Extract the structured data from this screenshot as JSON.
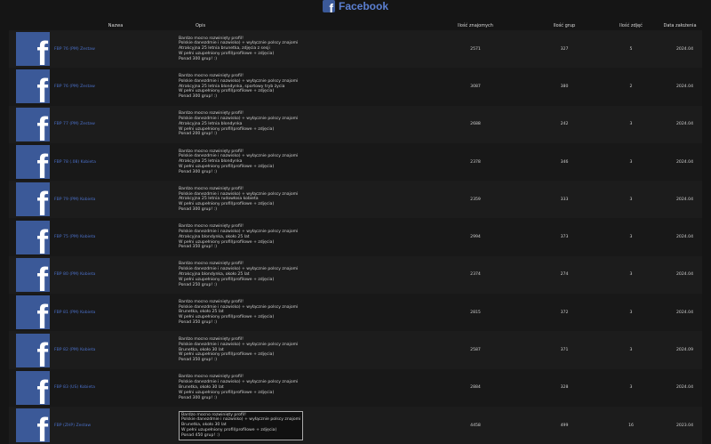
{
  "header": {
    "logo_glyph": "f",
    "brand": "Facebook"
  },
  "table": {
    "columns": [
      "Nazwa",
      "Opis",
      "Ilość znajomych",
      "Ilość grup",
      "Ilość zdjęć",
      "Data założenia"
    ],
    "rows": [
      {
        "name": "FBP 76 (PM) Zestaw",
        "desc": [
          "Bardzo mocno rozwinięty profil!",
          "Polskie danezdmie i nazwisko) + wyłącznie polscy znajomi",
          "Atrakcyjna 25 letnia brunetka, zdjęcia z sesji",
          "W pełni uzupełniony profil(profilowe + zdjęcia)",
          "Ponad 300 grup! :)"
        ],
        "friends": "2571",
        "groups": "327",
        "photos": "5",
        "date": "2024.04"
      },
      {
        "name": "FBP 76 (PM) Zestaw",
        "desc": [
          "Bardzo mocno rozwinięty profil!",
          "Polskie danezdmie i nazwisko) + wyłącznie polscy znajomi",
          "Atrakcyjna 25 letnia blondynka, sportowy tryb życia",
          "W pełni uzupełniony profil(profilowe + zdjęcia)",
          "Ponad 300 grup! :)"
        ],
        "friends": "3087",
        "groups": "380",
        "photos": "2",
        "date": "2024.04"
      },
      {
        "name": "FBP 77 (PM) Zestaw",
        "desc": [
          "Bardzo mocno rozwinięty profil!",
          "Polskie danezdmie i nazwisko) + wyłącznie polscy znajomi",
          "Atrakcyjna 25 letnia blondynka",
          "W pełni uzupełniony profil(profilowe + zdjęcia)",
          "Ponad 200 grup! :)"
        ],
        "friends": "2688",
        "groups": "242",
        "photos": "3",
        "date": "2024.04"
      },
      {
        "name": "FBP 78 (.08) Kobieta",
        "desc": [
          "Bardzo mocno rozwinięty profil!",
          "Polskie danezdmie i nazwisko) + wyłącznie polscy znajomi",
          "Atrakcyjna 25 letnia blondynka",
          "W pełni uzupełniony profil(profilowe + zdjęcia)",
          "Ponad 300 grup! :)"
        ],
        "friends": "2378",
        "groups": "346",
        "photos": "3",
        "date": "2024.04"
      },
      {
        "name": "FBP 79 (PM) Kobieta",
        "desc": [
          "Bardzo mocno rozwinięty profil!",
          "Polskie danezdmie i nazwisko) + wyłącznie polscy znajomi",
          "Atrakcyjna 25 letnia rudowłosa kobieta",
          "W pełni uzupełniony profil(profilowe + zdjęcia)",
          "Ponad 300 grup! :)"
        ],
        "friends": "2359",
        "groups": "333",
        "photos": "3",
        "date": "2024.04"
      },
      {
        "name": "FBP 75 (PM) Kobieta",
        "desc": [
          "Bardzo mocno rozwinięty profil!",
          "Polskie danezdmie i nazwisko) + wyłącznie polscy znajomi",
          "Atrakcyjna blondynka, około 25 lat",
          "W pełni uzupełniony profil(profilowe + zdjęcia)",
          "Ponad 350 grup! :)"
        ],
        "friends": "2994",
        "groups": "373",
        "photos": "3",
        "date": "2024.04"
      },
      {
        "name": "FBP 80 (PM) Kobieta",
        "desc": [
          "Bardzo mocno rozwinięty profil!",
          "Polskie danezdmie i nazwisko) + wyłącznie polscy znajomi",
          "Atrakcyjna blondynka, około 25 lat",
          "W pełni uzupełniony profil(profilowe + zdjęcia)",
          "Ponad 250 grup! :)"
        ],
        "friends": "2374",
        "groups": "274",
        "photos": "3",
        "date": "2024.04"
      },
      {
        "name": "FBP 81 (PM) Kobieta",
        "desc": [
          "Bardzo mocno rozwinięty profil!",
          "Polskie danezdmie i nazwisko) + wyłącznie polscy znajomi",
          "Brunetka, około 25 lat",
          "W pełni uzupełniony profil(profilowe + zdjęcia)",
          "Ponad 350 grup! :)"
        ],
        "friends": "2815",
        "groups": "372",
        "photos": "3",
        "date": "2024.04"
      },
      {
        "name": "FBP 82 (PM) Kobieta",
        "desc": [
          "Bardzo mocno rozwinięty profil!",
          "Polskie danezdmie i nazwisko) + wyłącznie polscy znajomi",
          "Brunetka, około 30 lat",
          "W pełni uzupełniony profil(profilowe + zdjęcia)",
          "Ponad 350 grup! :)"
        ],
        "friends": "2587",
        "groups": "371",
        "photos": "3",
        "date": "2024.09"
      },
      {
        "name": "FBP 83 (US) Kobieta",
        "desc": [
          "Bardzo mocno rozwinięty profil!",
          "Polskie danezdmie i nazwisko) + wyłącznie polscy znajomi",
          "Brunetka, około 30 lat",
          "W pełni uzupełniony profil(profilowe + zdjęcia)",
          "Ponad 300 grup! :)"
        ],
        "friends": "2884",
        "groups": "328",
        "photos": "3",
        "date": "2024.04"
      },
      {
        "name": "FBP (ZHP) Zestaw",
        "desc": [
          "Bardzo mocno rozwinięty profil!",
          "Polskie danezdmie i nazwisko) + wyłącznie polscy znajomi",
          "Brunetka, około 30 lat",
          "W pełni uzupełniony profil(profilowe + zdjęcia)",
          "Ponad 450 grup! :)"
        ],
        "friends": "4458",
        "groups": "499",
        "photos": "16",
        "date": "2023.04",
        "highlight": true
      }
    ]
  }
}
